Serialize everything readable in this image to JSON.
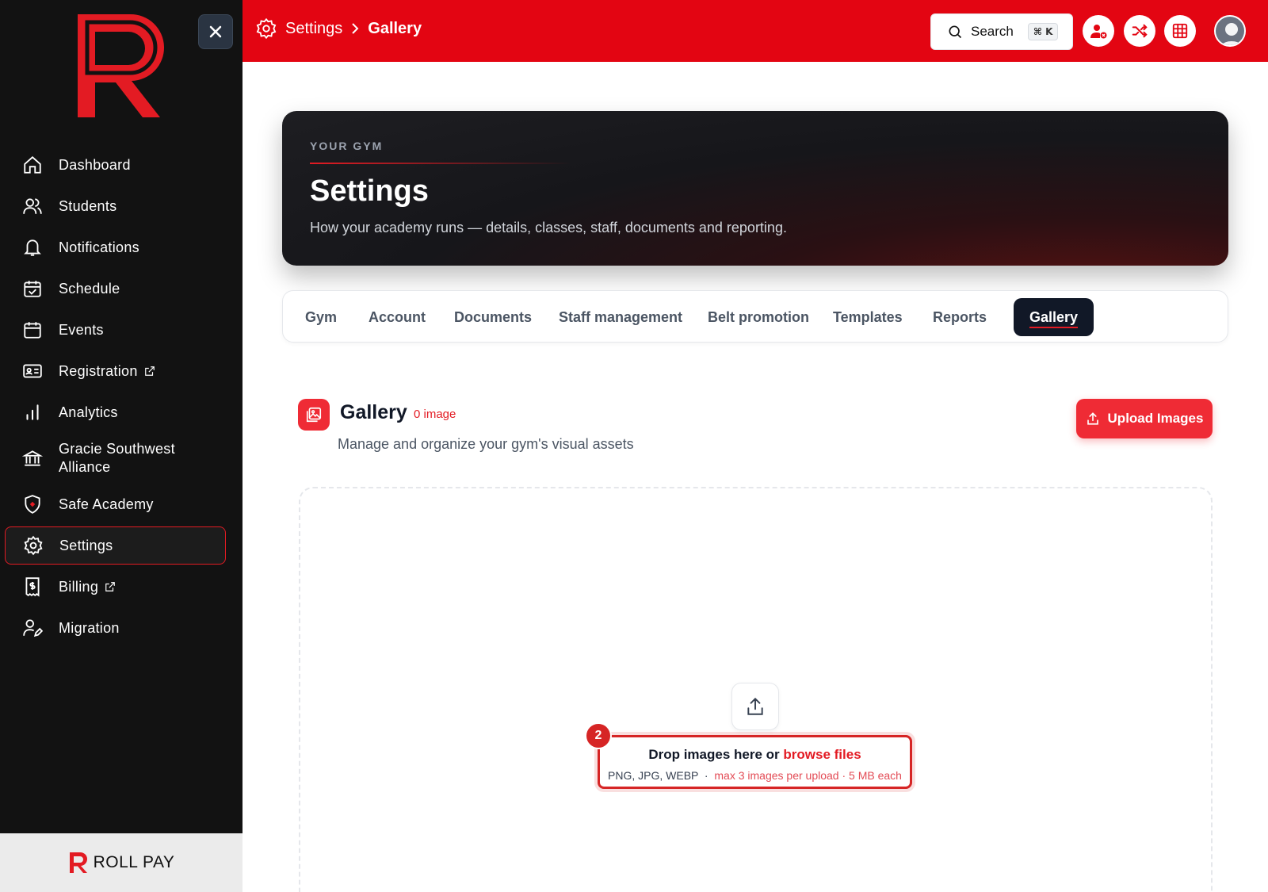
{
  "colors": {
    "accent": "#e30512",
    "sidebar_bg": "#121212",
    "tab_active_bg": "#111827"
  },
  "sidebar": {
    "items": [
      {
        "label": "Dashboard",
        "icon": "home-icon",
        "external": false
      },
      {
        "label": "Students",
        "icon": "users-icon",
        "external": false
      },
      {
        "label": "Notifications",
        "icon": "bell-icon",
        "external": false
      },
      {
        "label": "Schedule",
        "icon": "calendar-check-icon",
        "external": false
      },
      {
        "label": "Events",
        "icon": "calendar-icon",
        "external": false
      },
      {
        "label": "Registration",
        "icon": "id-card-icon",
        "external": true
      },
      {
        "label": "Analytics",
        "icon": "bar-chart-icon",
        "external": false
      },
      {
        "label": "Gracie Southwest Alliance",
        "icon": "bank-icon",
        "external": false
      },
      {
        "label": "Safe Academy",
        "icon": "shield-icon",
        "external": false
      },
      {
        "label": "Settings",
        "icon": "gear-icon",
        "external": false,
        "active": true
      },
      {
        "label": "Billing",
        "icon": "receipt-icon",
        "external": true
      },
      {
        "label": "Migration",
        "icon": "user-edit-icon",
        "external": false
      }
    ],
    "footer_brand": "ROLL PAY"
  },
  "header": {
    "breadcrumb_parent": "Settings",
    "breadcrumb_current": "Gallery",
    "search_label": "Search",
    "search_shortcut": "⌘ K"
  },
  "hero": {
    "eyebrow": "YOUR GYM",
    "title": "Settings",
    "subtitle": "How your academy runs — details, classes, staff, documents and reporting."
  },
  "tabs": [
    "Gym",
    "Account",
    "Documents",
    "Staff management",
    "Belt promotion",
    "Templates",
    "Reports",
    "Gallery"
  ],
  "active_tab": "Gallery",
  "gallery": {
    "title": "Gallery",
    "count": "0 image",
    "subtitle": "Manage and organize your gym's visual assets",
    "upload_label": "Upload Images"
  },
  "dropzone": {
    "badge": "2",
    "main_text": "Drop images here or ",
    "link_text": "browse files",
    "formats": "PNG, JPG, WEBP",
    "separator": "·",
    "limits": "max 3 images per upload · 5 MB each"
  }
}
